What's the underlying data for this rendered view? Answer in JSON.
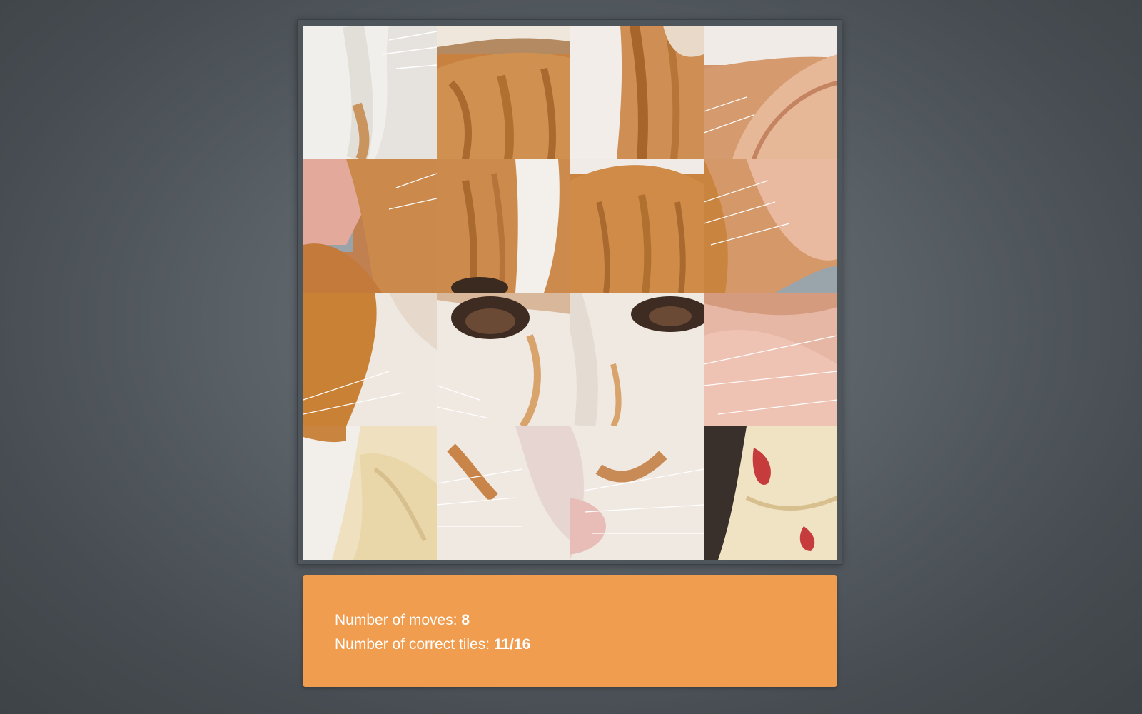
{
  "puzzle": {
    "grid_size": 4,
    "tiles": [
      {
        "index": 0,
        "content": "white fur and whiskers",
        "empty": false
      },
      {
        "index": 1,
        "content": "orange forehead",
        "empty": false
      },
      {
        "index": 2,
        "content": "white and orange stripe",
        "empty": false
      },
      {
        "index": 3,
        "content": "ear with window light",
        "empty": false
      },
      {
        "index": 4,
        "content": "left ear and face",
        "empty": false
      },
      {
        "index": 5,
        "content": "forehead blaze",
        "empty": false
      },
      {
        "index": 6,
        "content": "orange head top",
        "empty": false
      },
      {
        "index": 7,
        "content": "right ear",
        "empty": false
      },
      {
        "index": 8,
        "content": "left cheek",
        "empty": false
      },
      {
        "index": 9,
        "content": "left eye",
        "empty": false
      },
      {
        "index": 10,
        "content": "right eye",
        "empty": false
      },
      {
        "index": 11,
        "content": "inner ear",
        "empty": false
      },
      {
        "index": 12,
        "content": "paw and pillow",
        "empty": false
      },
      {
        "index": 13,
        "content": "muzzle left",
        "empty": false
      },
      {
        "index": 14,
        "content": "nose",
        "empty": false
      },
      {
        "index": 15,
        "content": "pillow with red pattern",
        "empty": false
      }
    ]
  },
  "status": {
    "moves_label": "Number of moves:",
    "moves_value": "8",
    "correct_label": "Number of correct tiles:",
    "correct_value": "11/16"
  },
  "colors": {
    "status_bg": "#f19d4f",
    "fur_orange": "#c98747",
    "fur_white": "#efe9e2"
  }
}
